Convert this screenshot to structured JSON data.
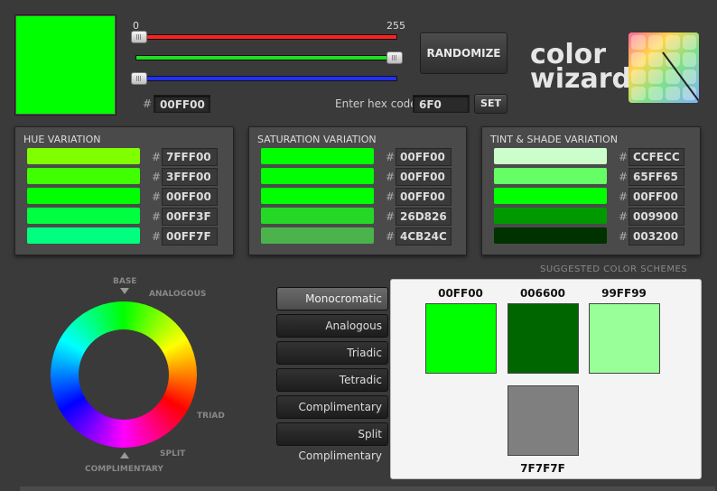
{
  "preview": {
    "color": "#00FF00"
  },
  "sliders": {
    "min_label": "0",
    "max_label": "255",
    "red": {
      "value": 0,
      "color": "#ff2020"
    },
    "green": {
      "value": 255,
      "color": "#22dd22"
    },
    "blue": {
      "value": 0,
      "color": "#2030ff"
    }
  },
  "current_hex": {
    "hash": "#",
    "value": "00FF00"
  },
  "hex_entry": {
    "label": "Enter hex code:",
    "value": "6F0",
    "set_label": "SET"
  },
  "randomize_label": "RANDOMIZE",
  "logo": {
    "line1": "color",
    "line2": "wizard"
  },
  "panels": {
    "hue": {
      "title": "HUE VARIATION",
      "rows": [
        {
          "color": "#7FFF00",
          "hex": "7FFF00"
        },
        {
          "color": "#3FFF00",
          "hex": "3FFF00"
        },
        {
          "color": "#00FF00",
          "hex": "00FF00"
        },
        {
          "color": "#00FF3F",
          "hex": "00FF3F"
        },
        {
          "color": "#00FF7F",
          "hex": "00FF7F"
        }
      ]
    },
    "saturation": {
      "title": "SATURATION VARIATION",
      "rows": [
        {
          "color": "#00FF00",
          "hex": "00FF00"
        },
        {
          "color": "#00FF00",
          "hex": "00FF00"
        },
        {
          "color": "#00FF00",
          "hex": "00FF00"
        },
        {
          "color": "#26D826",
          "hex": "26D826"
        },
        {
          "color": "#4CB24C",
          "hex": "4CB24C"
        }
      ]
    },
    "tint": {
      "title": "TINT & SHADE VARIATION",
      "rows": [
        {
          "color": "#CCFECC",
          "hex": "CCFECC"
        },
        {
          "color": "#65FF65",
          "hex": "65FF65"
        },
        {
          "color": "#00FF00",
          "hex": "00FF00"
        },
        {
          "color": "#009900",
          "hex": "009900"
        },
        {
          "color": "#003200",
          "hex": "003200"
        }
      ]
    }
  },
  "hash_symbol": "#",
  "suggested_label": "SUGGESTED COLOR SCHEMES",
  "wheel_labels": {
    "base": "BASE",
    "analogous": "ANALOGOUS",
    "triad": "TRIAD",
    "split": "SPLIT",
    "complimentary": "COMPLIMENTARY"
  },
  "schemes": [
    {
      "label": "Monocromatic",
      "active": true
    },
    {
      "label": "Analogous",
      "active": false
    },
    {
      "label": "Triadic",
      "active": false
    },
    {
      "label": "Tetradic",
      "active": false
    },
    {
      "label": "Complimentary",
      "active": false
    },
    {
      "label": "Split Complimentary",
      "active": false
    }
  ],
  "results": [
    {
      "hex": "00FF00",
      "color": "#00FF00"
    },
    {
      "hex": "006600",
      "color": "#006600"
    },
    {
      "hex": "99FF99",
      "color": "#99FF99"
    },
    {
      "hex": "7F7F7F",
      "color": "#7F7F7F"
    }
  ]
}
